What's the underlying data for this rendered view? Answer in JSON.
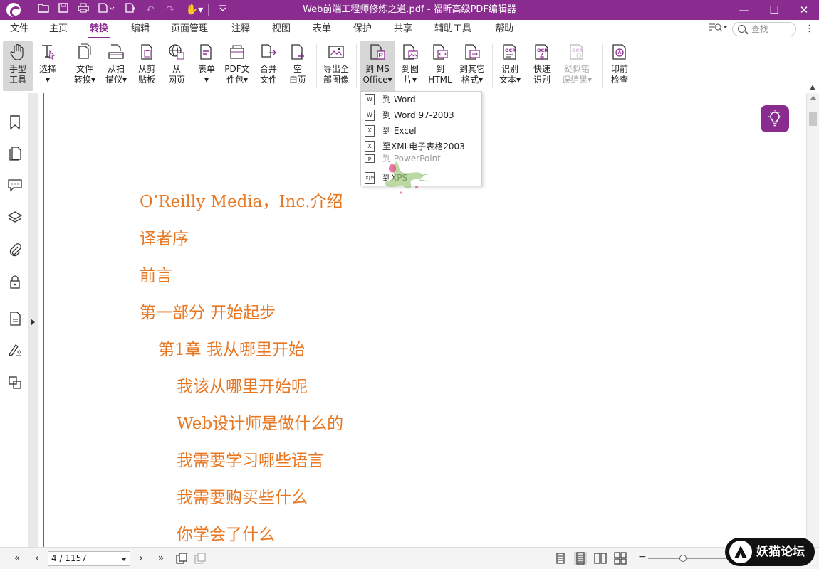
{
  "window": {
    "title": "Web前端工程师修炼之道.pdf - 福昕高级PDF编辑器",
    "minimize": "—",
    "maximize": "☐",
    "close": "✕"
  },
  "menu": {
    "items": [
      "文件",
      "主页",
      "转换",
      "编辑",
      "页面管理",
      "注释",
      "视图",
      "表单",
      "保护",
      "共享",
      "辅助工具",
      "帮助"
    ],
    "active": "转换",
    "search_placeholder": "查找",
    "more": "⋮"
  },
  "ribbon": {
    "tools": [
      {
        "label1": "手型",
        "label2": "工具",
        "icon": "hand-icon"
      },
      {
        "label1": "选择",
        "label2": "▾",
        "icon": "select-cursor-icon"
      },
      {
        "label1": "文件",
        "label2": "转换▾",
        "icon": "file-convert-icon"
      },
      {
        "label1": "从扫",
        "label2": "描仪▾",
        "icon": "scanner-icon"
      },
      {
        "label1": "从剪",
        "label2": "贴板",
        "icon": "clipboard-icon"
      },
      {
        "label1": "从",
        "label2": "网页",
        "icon": "globe-icon"
      },
      {
        "label1": "表单",
        "label2": "▾",
        "icon": "form-icon"
      },
      {
        "label1": "PDF文",
        "label2": "件包▾",
        "icon": "pdf-package-icon"
      },
      {
        "label1": "合并",
        "label2": "文件",
        "icon": "merge-icon"
      },
      {
        "label1": "空",
        "label2": "白页",
        "icon": "blank-page-icon"
      },
      {
        "label1": "导出全",
        "label2": "部图像",
        "icon": "export-images-icon"
      },
      {
        "label1": "到 MS",
        "label2": "Office▾",
        "icon": "ms-office-icon"
      },
      {
        "label1": "到图",
        "label2": "片▾",
        "icon": "to-image-icon"
      },
      {
        "label1": "到",
        "label2": "HTML",
        "icon": "to-html-icon"
      },
      {
        "label1": "到其它",
        "label2": "格式▾",
        "icon": "other-format-icon"
      },
      {
        "label1": "识别",
        "label2": "文本▾",
        "icon": "ocr-icon"
      },
      {
        "label1": "快速",
        "label2": "识别",
        "icon": "quick-ocr-icon"
      },
      {
        "label1": "疑似错",
        "label2": "误结果▾",
        "icon": "ocr-suspect-icon"
      },
      {
        "label1": "印前",
        "label2": "检查",
        "icon": "preflight-icon"
      }
    ]
  },
  "dropdown": {
    "items": [
      "到 Word",
      "到 Word 97-2003",
      "到 Excel",
      "至XML电子表格2003",
      "到 PowerPoint",
      "到XPS"
    ]
  },
  "document": {
    "toc": [
      {
        "text": "O’Reilly Media，Inc.介绍",
        "level": 0
      },
      {
        "text": "译者序",
        "level": 0
      },
      {
        "text": "前言",
        "level": 0
      },
      {
        "text": "第一部分 开始起步",
        "level": 0
      },
      {
        "text": "第1章 我从哪里开始",
        "level": 1
      },
      {
        "text": "我该从哪里开始呢",
        "level": 2
      },
      {
        "text": "Web设计师是做什么的",
        "level": 2
      },
      {
        "text": "我需要学习哪些语言",
        "level": 2
      },
      {
        "text": "我需要购买些什么",
        "level": 2
      },
      {
        "text": "你学会了什么",
        "level": 2
      }
    ],
    "text_color": "#e87722"
  },
  "statusbar": {
    "page": "4 / 1157",
    "first": "«",
    "prev": "‹",
    "next": "›",
    "last": "»"
  },
  "watermark": {
    "text": "妖猫论坛"
  },
  "colors": {
    "accent": "#8a2c8f",
    "toc": "#e87722"
  }
}
